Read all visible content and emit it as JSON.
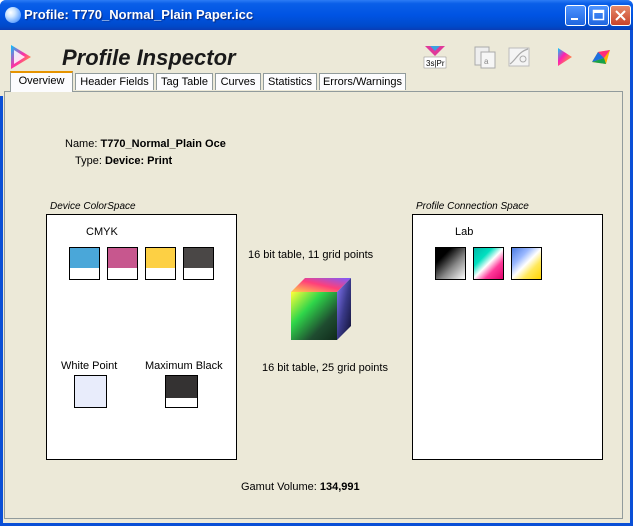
{
  "window": {
    "title": "Profile: T770_Normal_Plain Paper.icc"
  },
  "header": {
    "app_title": "Profile Inspector"
  },
  "toolbar": {
    "items": [
      {
        "name": "header-fields-tool",
        "label": "3s|Pr"
      },
      {
        "name": "tag-table-tool"
      },
      {
        "name": "curves-tool"
      },
      {
        "name": "gamut-tool"
      },
      {
        "name": "colorwheel-tool"
      }
    ]
  },
  "tabs": [
    {
      "label": "Overview",
      "active": true
    },
    {
      "label": "Header Fields",
      "active": false
    },
    {
      "label": "Tag Table",
      "active": false
    },
    {
      "label": "Curves",
      "active": false
    },
    {
      "label": "Statistics",
      "active": false
    },
    {
      "label": "Errors/Warnings",
      "active": false
    }
  ],
  "overview": {
    "name_label": "Name:",
    "name_value": "T770_Normal_Plain Oce",
    "type_label": "Type:",
    "type_value": "Device: Print",
    "device_space": {
      "label": "Device ColorSpace",
      "space_name": "CMYK",
      "channels": [
        {
          "name": "cyan",
          "color": "#4aa7d9"
        },
        {
          "name": "magenta",
          "color": "#c7578e"
        },
        {
          "name": "yellow",
          "color": "#fdd044"
        },
        {
          "name": "black",
          "color": "#4a4746"
        }
      ],
      "white_point_label": "White Point",
      "white_point_color": "#e8ecfb",
      "max_black_label": "Maximum Black",
      "max_black_color": "#343232"
    },
    "a2b_text": "16 bit table, 11 grid points",
    "b2a_text": "16 bit table, 25 grid points",
    "pcs": {
      "label": "Profile Connection Space",
      "space_name": "Lab"
    },
    "gamut_label": "Gamut Volume:",
    "gamut_value": "134,991"
  }
}
